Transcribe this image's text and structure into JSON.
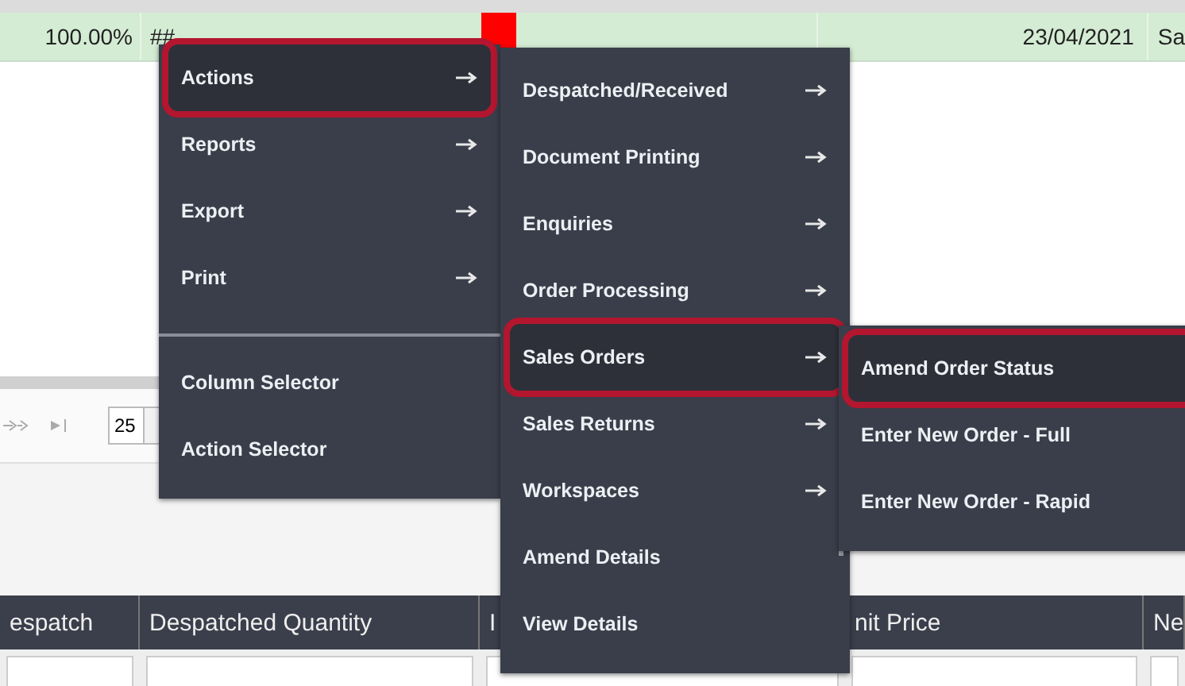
{
  "grid_row": {
    "percent": "100.00%",
    "code": "##",
    "date": "23/04/2021",
    "column_last": "Sa"
  },
  "pager": {
    "page_size": "25"
  },
  "table": {
    "columns": [
      "espatch",
      "Despatched Quantity",
      "I",
      "nit Price",
      "Ne"
    ]
  },
  "menus": [
    {
      "items": [
        {
          "label": "Actions",
          "has_submenu": true,
          "selected": true
        },
        {
          "label": "Reports",
          "has_submenu": true,
          "selected": false
        },
        {
          "label": "Export",
          "has_submenu": true,
          "selected": false
        },
        {
          "label": "Print",
          "has_submenu": true,
          "selected": false
        },
        {
          "kind": "separator"
        },
        {
          "label": "Column Selector",
          "has_submenu": false,
          "selected": false
        },
        {
          "label": "Action Selector",
          "has_submenu": false,
          "selected": false
        }
      ]
    },
    {
      "items": [
        {
          "label": "Despatched/Received",
          "has_submenu": true,
          "selected": false
        },
        {
          "label": "Document Printing",
          "has_submenu": true,
          "selected": false
        },
        {
          "label": "Enquiries",
          "has_submenu": true,
          "selected": false
        },
        {
          "label": "Order Processing",
          "has_submenu": true,
          "selected": false
        },
        {
          "label": "Sales Orders",
          "has_submenu": true,
          "selected": true
        },
        {
          "label": "Sales Returns",
          "has_submenu": true,
          "selected": false
        },
        {
          "label": "Workspaces",
          "has_submenu": true,
          "selected": false
        },
        {
          "label": "Amend Details",
          "has_submenu": false,
          "selected": false
        },
        {
          "label": "View Details",
          "has_submenu": false,
          "selected": false
        }
      ]
    },
    {
      "items": [
        {
          "label": "Amend Order Status",
          "has_submenu": false,
          "selected": true
        },
        {
          "label": "Enter New Order - Full",
          "has_submenu": false,
          "selected": false
        },
        {
          "label": "Enter New Order - Rapid",
          "has_submenu": false,
          "selected": false
        }
      ]
    }
  ]
}
